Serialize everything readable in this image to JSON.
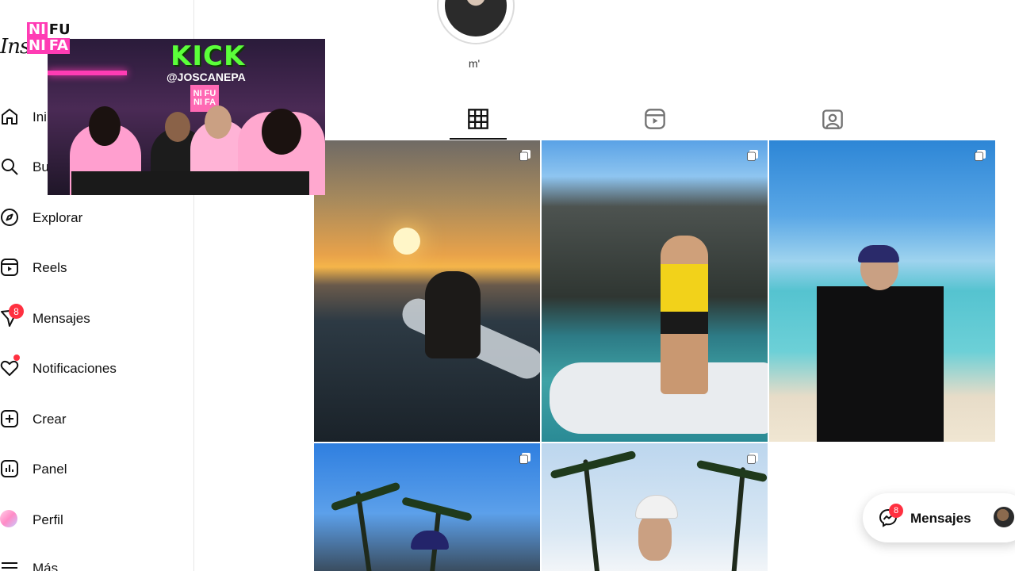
{
  "sidebar": {
    "logo_text": "Inst",
    "items": [
      {
        "label": "Ini",
        "icon": "home-icon"
      },
      {
        "label": "Bu",
        "icon": "search-icon"
      },
      {
        "label": "Explorar",
        "icon": "compass-icon"
      },
      {
        "label": "Reels",
        "icon": "reels-icon"
      },
      {
        "label": "Mensajes",
        "icon": "messenger-icon",
        "badge": "8"
      },
      {
        "label": "Notificaciones",
        "icon": "heart-icon"
      },
      {
        "label": "Crear",
        "icon": "plus-square-icon"
      },
      {
        "label": "Panel",
        "icon": "chart-icon"
      },
      {
        "label": "Perfil",
        "icon": "avatar-icon"
      },
      {
        "label": "Más",
        "icon": "menu-icon"
      }
    ]
  },
  "overlay": {
    "logo_lines": [
      "NI",
      "FU",
      "NI",
      "FA"
    ],
    "webcam_banner": "KICK",
    "webcam_handle": "@JOSCANEPA",
    "webcam_sign": "NI FU NI FA"
  },
  "profile": {
    "name": "m'"
  },
  "tabs": [
    {
      "name": "posts",
      "icon": "grid-icon",
      "active": true
    },
    {
      "name": "reels",
      "icon": "reels-icon",
      "active": false
    },
    {
      "name": "tagged",
      "icon": "tagged-icon",
      "active": false
    }
  ],
  "posts": [
    {
      "type": "multi",
      "scene": "sunset-paddleboard"
    },
    {
      "type": "multi",
      "scene": "jetski-cliffs"
    },
    {
      "type": "multi",
      "scene": "beach-pose"
    },
    {
      "type": "multi",
      "scene": "palms-navy-cap"
    },
    {
      "type": "multi",
      "scene": "palms-white-cap"
    }
  ],
  "messages_pill": {
    "label": "Mensajes",
    "badge": "8"
  },
  "colors": {
    "badge": "#ff3040",
    "active_tab": "#111111",
    "kick_green": "#5bff3a",
    "neon_pink": "#ff3cb4"
  }
}
